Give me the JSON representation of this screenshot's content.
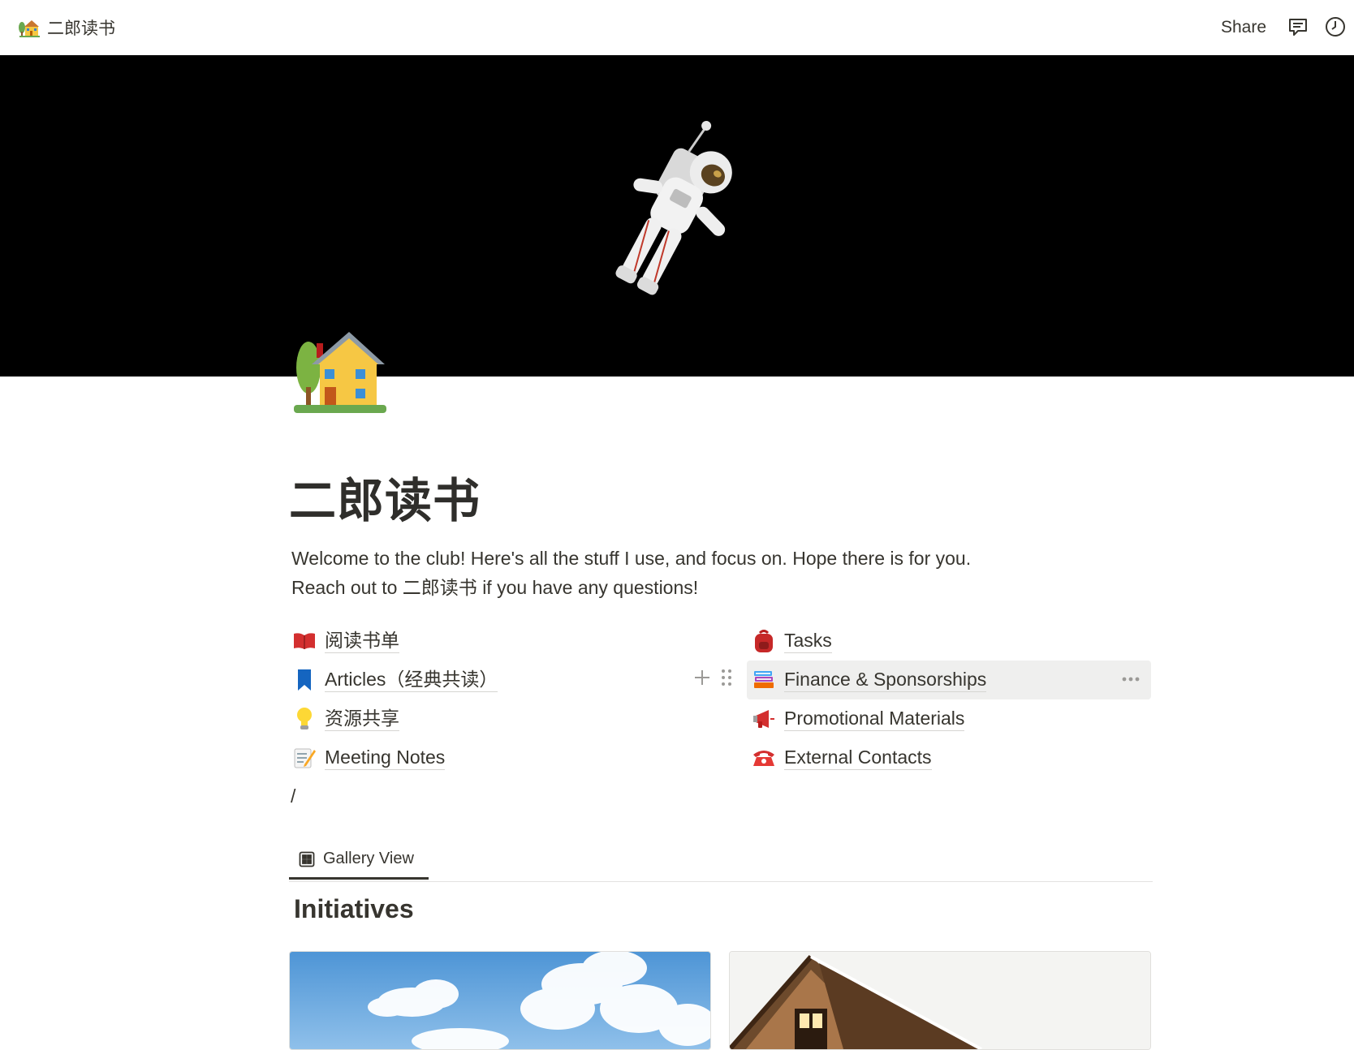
{
  "breadcrumb": {
    "title": "二郎读书",
    "icon": "house-with-garden-icon"
  },
  "topbar": {
    "share_label": "Share",
    "comments_icon": "comment-icon",
    "updates_icon": "clock-icon"
  },
  "page": {
    "icon": "house-with-garden-icon",
    "title": "二郎读书",
    "description": [
      "Welcome to the club! Here's all the stuff  I use, and focus on.  Hope there is for you.",
      "Reach out to 二郎读书 if you have any questions!"
    ]
  },
  "links_left": [
    {
      "label": "阅读书单",
      "icon": "open-book-icon"
    },
    {
      "label": "Articles（经典共读）",
      "icon": "bookmark-icon"
    },
    {
      "label": "资源共享",
      "icon": "light-bulb-icon"
    },
    {
      "label": "Meeting Notes",
      "icon": "memo-icon"
    }
  ],
  "links_right": [
    {
      "label": "Tasks",
      "icon": "backpack-icon"
    },
    {
      "label": "Finance & Sponsorships",
      "icon": "books-icon"
    },
    {
      "label": "Promotional Materials",
      "icon": "megaphone-icon"
    },
    {
      "label": "External Contacts",
      "icon": "telephone-icon"
    }
  ],
  "slash_text": "/",
  "view_tab": {
    "label": "Gallery View",
    "icon": "gallery-icon"
  },
  "section_title": "Initiatives",
  "colors": {
    "text": "#37352f",
    "hover_bg": "#efefee",
    "cover_bg": "#000000"
  }
}
